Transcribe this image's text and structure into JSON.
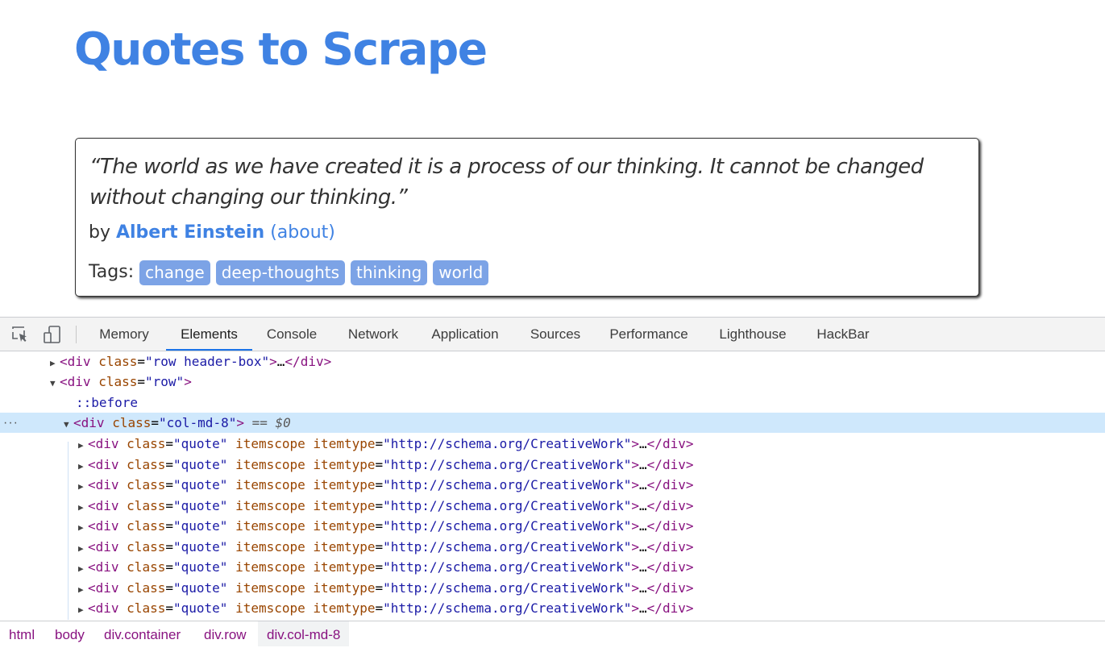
{
  "page": {
    "title": "Quotes to Scrape",
    "quote": {
      "text": "“The world as we have created it is a process of our thinking. It cannot be changed without changing our thinking.”",
      "by_label": "by",
      "author": "Albert Einstein",
      "about_link": "(about)",
      "tags_label": "Tags:",
      "tags": [
        "change",
        "deep-thoughts",
        "thinking",
        "world"
      ]
    }
  },
  "devtools": {
    "tabs": [
      "Memory",
      "Elements",
      "Console",
      "Network",
      "Application",
      "Sources",
      "Performance",
      "Lighthouse",
      "HackBar"
    ],
    "active_tab": "Elements",
    "icons": [
      "inspect-element-icon",
      "device-toolbar-icon"
    ],
    "dom": {
      "header_box": {
        "tag": "div",
        "attr": "class",
        "value": "row header-box",
        "collapsed": "…"
      },
      "row": {
        "tag": "div",
        "attr": "class",
        "value": "row"
      },
      "before_pseudo": "::before",
      "selected": {
        "tag": "div",
        "attr": "class",
        "value": "col-md-8",
        "suffix": "== $0"
      },
      "more_button": "···",
      "quote_rows": [
        {
          "class_value": "quote",
          "scope_attr": "itemscope",
          "type_attr": "itemtype",
          "type_value": "http://schema.org/CreativeWork"
        },
        {
          "class_value": "quote",
          "scope_attr": "itemscope",
          "type_attr": "itemtype",
          "type_value": "http://schema.org/CreativeWork"
        },
        {
          "class_value": "quote",
          "scope_attr": "itemscope",
          "type_attr": "itemtype",
          "type_value": "http://schema.org/CreativeWork"
        },
        {
          "class_value": "quote",
          "scope_attr": "itemscope",
          "type_attr": "itemtype",
          "type_value": "http://schema.org/CreativeWork"
        },
        {
          "class_value": "quote",
          "scope_attr": "itemscope",
          "type_attr": "itemtype",
          "type_value": "http://schema.org/CreativeWork"
        },
        {
          "class_value": "quote",
          "scope_attr": "itemscope",
          "type_attr": "itemtype",
          "type_value": "http://schema.org/CreativeWork"
        },
        {
          "class_value": "quote",
          "scope_attr": "itemscope",
          "type_attr": "itemtype",
          "type_value": "http://schema.org/CreativeWork"
        },
        {
          "class_value": "quote",
          "scope_attr": "itemscope",
          "type_attr": "itemtype",
          "type_value": "http://schema.org/CreativeWork"
        },
        {
          "class_value": "quote",
          "scope_attr": "itemscope",
          "type_attr": "itemtype",
          "type_value": "http://schema.org/CreativeWork"
        }
      ]
    },
    "breadcrumbs": [
      "html",
      "body",
      "div.container",
      "div.row",
      "div.col-md-8"
    ],
    "active_breadcrumb": "div.col-md-8"
  },
  "colors": {
    "brand": "#3f82e3",
    "tag_bg": "#7ca3e6",
    "selected_row": "#cfe8fc",
    "tab_underline": "#1a73e8"
  }
}
